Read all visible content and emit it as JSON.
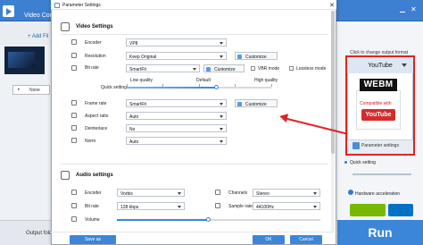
{
  "background_app": {
    "title": "Video Con",
    "add_files": "+ Add Fil",
    "none_label": "None",
    "output_folder": "Output folder",
    "run_label": "Run",
    "format_hint": "Click to change output format",
    "format_name": "YouTube",
    "webm_logo": "WEBM",
    "compatible_text": "Compatible with",
    "youtube_badge": "YouTube",
    "parameter_settings_label": "Parameter settings",
    "quick_setting": "Quick setting",
    "hardware_acceleration": "Hardware acceleration"
  },
  "dialog": {
    "title": "Parameter Settings",
    "video_settings": {
      "heading": "Video Settings",
      "encoder_label": "Encoder",
      "encoder_value": "VP8",
      "resolution_label": "Resolution",
      "resolution_value": "Keep Original",
      "customize_label": "Customize",
      "bitrate_label": "Bit rate",
      "bitrate_value": "SmartFit",
      "bitrate_customize_label": "Customize",
      "vbr_label": "VBR mode",
      "lossless_label": "Lossless mode",
      "quick_setting_label": "Quick setting",
      "quality_low": "Low quality",
      "quality_default": "Default",
      "quality_high": "High quality",
      "quality_level": 0.62,
      "framerate_label": "Frame rate",
      "framerate_value": "SmartFit",
      "framerate_customize_label": "Customize",
      "aspect_label": "Aspect ratio",
      "aspect_value": "Auto",
      "deinterlace_label": "Deinterlace",
      "deinterlace_value": "No",
      "norm_label": "Norm",
      "norm_value": "Auto"
    },
    "audio_settings": {
      "heading": "Audio settings",
      "encoder_label": "Encoder",
      "encoder_value": "Vorbis",
      "channels_label": "Channels",
      "channels_value": "Stereo",
      "bitrate_label": "Bit rate",
      "bitrate_value": "128 kbps",
      "samplerate_label": "Sample rate",
      "samplerate_value": "44100Hz",
      "volume_label": "Volume",
      "volume_level": 0.45
    },
    "save_as_label": "Save as",
    "ok_label": "OK",
    "cancel_label": "Cancel"
  },
  "colors": {
    "accent": "#3b86d8",
    "highlight": "#e02424"
  }
}
